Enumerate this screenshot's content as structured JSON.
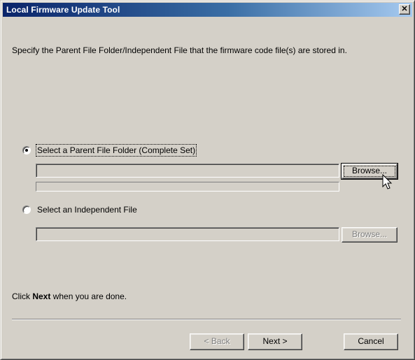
{
  "window": {
    "title": "Local Firmware Update Tool",
    "close_glyph": "✕"
  },
  "intro_text": "Specify the Parent File Folder/Independent File that the firmware code file(s) are stored in.",
  "option_parent": {
    "label": "Select a Parent File Folder (Complete Set)",
    "selected": true,
    "path_value": "",
    "browse_label": "Browse..."
  },
  "option_independent": {
    "label": "Select an Independent File",
    "selected": false,
    "path_value": "",
    "browse_label": "Browse..."
  },
  "done_hint": {
    "prefix": "Click ",
    "bold": "Next",
    "suffix": " when you are done."
  },
  "footer": {
    "back_label": "< Back",
    "next_label": "Next >",
    "cancel_label": "Cancel"
  },
  "icons": {
    "close": "close-icon",
    "cursor": "mouse-pointer-icon"
  }
}
